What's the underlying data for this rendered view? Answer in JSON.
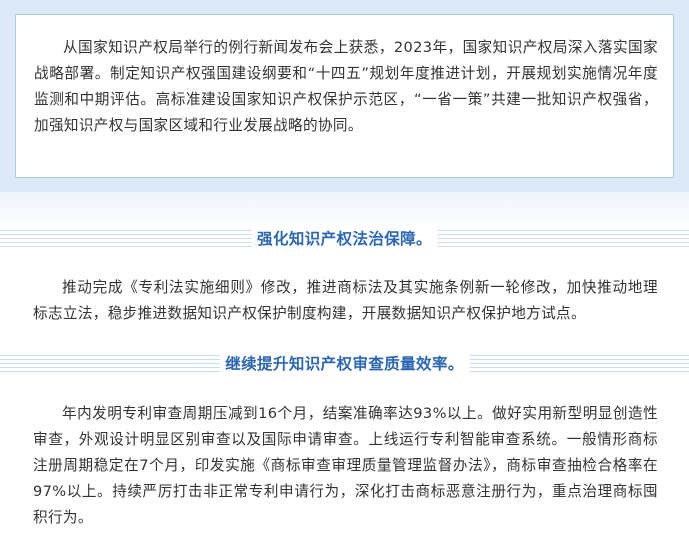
{
  "intro": {
    "text": "从国家知识产权局举行的例行新闻发布会上获悉，2023年，国家知识产权局深入落实国家战略部署。制定知识产权强国建设纲要和“十四五”规划年度推进计划，开展规划实施情况年度监测和中期评估。高标准建设国家知识产权保护示范区，“一省一策”共建一批知识产权强省，加强知识产权与国家区域和行业发展战略的协同。"
  },
  "sections": [
    {
      "heading": "强化知识产权法治保障。",
      "body": "推动完成《专利法实施细则》修改，推进商标法及其实施条例新一轮修改，加快推动地理标志立法，稳步推进数据知识产权保护制度构建，开展数据知识产权保护地方试点。"
    },
    {
      "heading": "继续提升知识产权审查质量效率。",
      "body": "年内发明专利审查周期压减到16个月，结案准确率达93%以上。做好实用新型明显创造性审查，外观设计明显区别审查以及国际申请审查。上线运行专利智能审查系统。一般情形商标注册周期稳定在7个月，印发实施《商标审查审理质量管理监督办法》，商标审查抽检合格率在97%以上。持续严厉打击非正常专利申请行为，深化打击商标恶意注册行为，重点治理商标囤积行为。"
    }
  ],
  "colors": {
    "band": "#dde9f7",
    "frame_border": "#a9c8ec",
    "heading_text": "#2b67b4",
    "stripe": "#c9dcf1",
    "body_text": "#333333"
  }
}
